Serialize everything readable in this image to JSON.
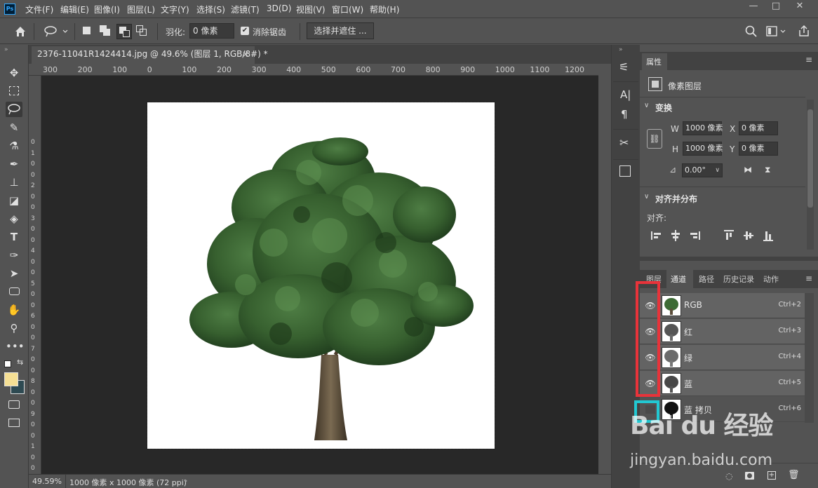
{
  "menubar": {
    "logo": "Ps",
    "items": [
      "文件(F)",
      "编辑(E)",
      "图像(I)",
      "图层(L)",
      "文字(Y)",
      "选择(S)",
      "滤镜(T)",
      "3D(D)",
      "视图(V)",
      "窗口(W)",
      "帮助(H)"
    ],
    "min": "—",
    "max": "□",
    "close": "✕"
  },
  "options": {
    "feather_label": "羽化:",
    "feather_value": "0 像素",
    "antialias_label": "消除锯齿",
    "select_mask": "选择并遮住 ..."
  },
  "document": {
    "tab_title": "2376-11041R1424414.jpg @ 49.6% (图层 1, RGB/8#) *",
    "zoom": "49.59%",
    "size_info": "1000 像素 x 1000 像素 (72 ppi)"
  },
  "ruler_h": [
    "300",
    "200",
    "100",
    "0",
    "100",
    "200",
    "300",
    "400",
    "500",
    "600",
    "700",
    "800",
    "900",
    "1000",
    "1100",
    "1200"
  ],
  "ruler_v": [
    "0",
    "1",
    "0",
    "0",
    "2",
    "0",
    "0",
    "3",
    "0",
    "0",
    "4",
    "0",
    "0",
    "5",
    "0",
    "0",
    "6",
    "0",
    "0",
    "7",
    "0",
    "0",
    "8",
    "0",
    "0",
    "9",
    "0",
    "0",
    "1",
    "0",
    "0"
  ],
  "properties": {
    "tab": "属性",
    "layer_type": "像素图层",
    "transform_label": "变换",
    "w_label": "W",
    "w_value": "1000 像素",
    "h_label": "H",
    "h_value": "1000 像素",
    "x_label": "X",
    "x_value": "0 像素",
    "y_label": "Y",
    "y_value": "0 像素",
    "angle": "0.00°",
    "align_label": "对齐并分布",
    "align_sub": "对齐:"
  },
  "panel_tabs": [
    "图层",
    "通道",
    "路径",
    "历史记录",
    "动作"
  ],
  "channels": [
    {
      "name": "RGB",
      "shortcut": "Ctrl+2"
    },
    {
      "name": "红",
      "shortcut": "Ctrl+3"
    },
    {
      "name": "绿",
      "shortcut": "Ctrl+4"
    },
    {
      "name": "蓝",
      "shortcut": "Ctrl+5"
    },
    {
      "name": "蓝 拷贝",
      "shortcut": "Ctrl+6"
    }
  ],
  "watermark": {
    "brand": "Bai du 经验",
    "url": "jingyan.baidu.com"
  },
  "colors": {
    "foreground": "#f5df94",
    "background": "#2e4a52",
    "highlight_red": "#e8333a",
    "highlight_cyan": "#22c8d2",
    "tree_green": "#3d6b35",
    "trunk": "#5b4d3a"
  }
}
